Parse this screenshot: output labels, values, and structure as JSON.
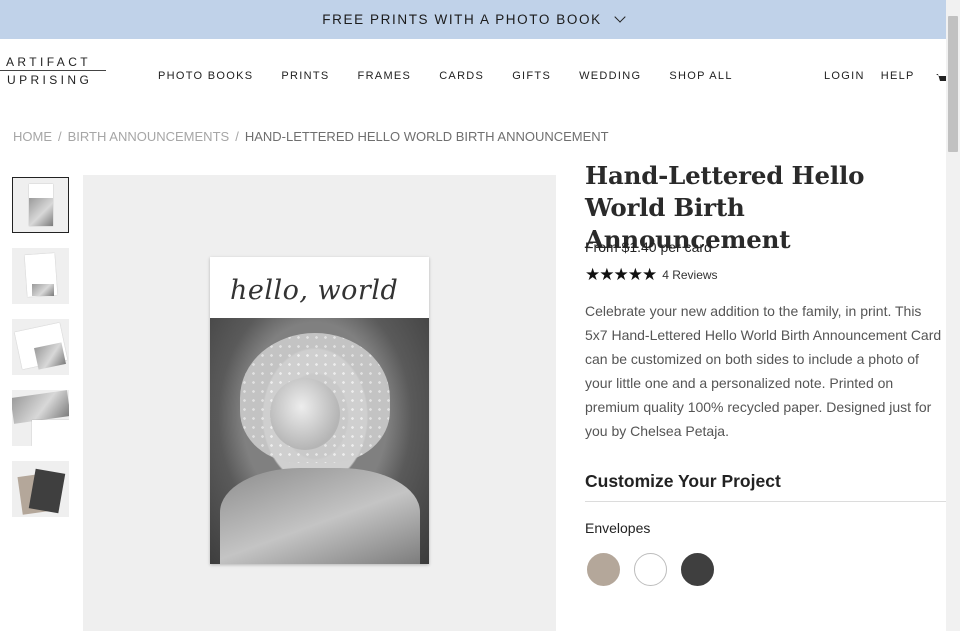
{
  "promo": {
    "text": "FREE PRINTS WITH A PHOTO BOOK"
  },
  "logo": {
    "line1": "ARTIFACT",
    "line2": "UPRISING"
  },
  "nav": {
    "items": [
      "PHOTO BOOKS",
      "PRINTS",
      "FRAMES",
      "CARDS",
      "GIFTS",
      "WEDDING",
      "SHOP ALL"
    ]
  },
  "utility": {
    "login": "LOGIN",
    "help": "HELP"
  },
  "breadcrumb": {
    "items": [
      "HOME",
      "BIRTH ANNOUNCEMENTS",
      "HAND-LETTERED HELLO WORLD BIRTH ANNOUNCEMENT"
    ],
    "separator": "/"
  },
  "product": {
    "title": "Hand-Lettered Hello World Birth Announcement",
    "price": "From $1.40 per card",
    "rating": 5,
    "stars": "★★★★★",
    "reviews": "4 Reviews",
    "description": "Celebrate your new addition to the family, in print. This 5x7 Hand-Lettered Hello World Birth Announcement Card can be customized on both sides to include a photo of your little one and a personalized note. Printed on premium quality 100% recycled paper. Designed just for you by Chelsea Petaja.",
    "card_text": "hello, world"
  },
  "customize": {
    "title": "Customize Your Project",
    "envelopes_label": "Envelopes"
  },
  "envelopes": [
    {
      "name": "taupe",
      "color": "#b4a79a"
    },
    {
      "name": "white",
      "color": "#ffffff"
    },
    {
      "name": "charcoal",
      "color": "#3f3f3f"
    }
  ],
  "colors": {
    "promo_bg": "#c0d2e9",
    "image_bg": "#efefef"
  }
}
